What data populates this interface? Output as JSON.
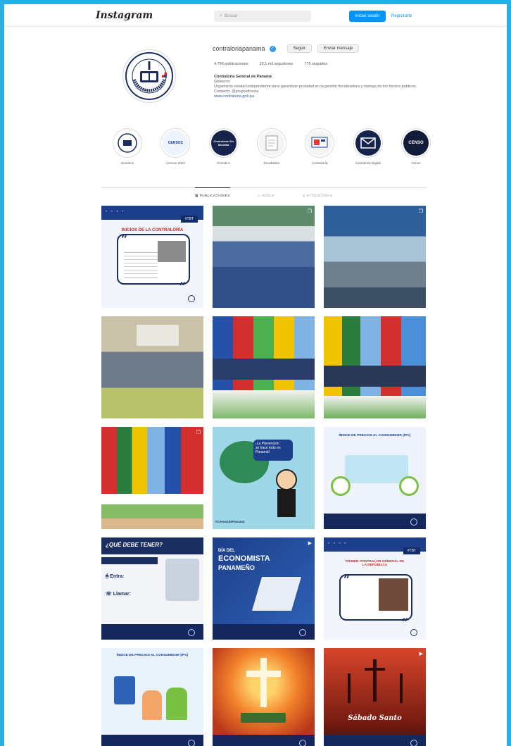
{
  "topbar": {
    "logo": "Instagram",
    "search_placeholder": "Buscar",
    "login_label": "Iniciar sesión",
    "signup_label": "Registrarte"
  },
  "profile": {
    "username": "contraloriapanama",
    "follow_label": "Seguir",
    "message_label": "Enviar mensaje",
    "stats": {
      "posts": "4.796 publicaciones",
      "followers": "23,1 mil seguidores",
      "following": "775 seguidos"
    },
    "bio": {
      "name": "Contraloría General de Panamá",
      "category": "Gobierno",
      "description": "Organismo estatal independiente para garantizar probidad en la gestión fiscalizadora y manejo de los fondos públicos.",
      "contact": "Contacto: @grupoeficacia",
      "website": "www.contraloria.gob.pa"
    }
  },
  "highlights": [
    {
      "label": "Nosotros",
      "bg": "#ffffff",
      "text": ""
    },
    {
      "label": "Censos 2023",
      "bg": "#eef4fb",
      "text": "CENSOS"
    },
    {
      "label": "Periódico",
      "bg": "#16244d",
      "text": "Contraloría Sin Mordida"
    },
    {
      "label": "Resultados",
      "bg": "#f4f4f4",
      "text": ""
    },
    {
      "label": "Contraloría",
      "bg": "#f4f4f4",
      "text": ""
    },
    {
      "label": "Contraloría Digital",
      "bg": "#16244d",
      "text": "Contraloría"
    },
    {
      "label": "Censo",
      "bg": "#101c3a",
      "text": "CENSO"
    }
  ],
  "tabs": [
    "PUBLICACIONES",
    "REELS",
    "ETIQUETADAS"
  ],
  "posts": {
    "p1_tag": "#TBT",
    "p1_title": "INICIOS DE LA CONTRALORÍA",
    "p8_line1": "¡La Prevención",
    "p8_line2": "se hace todo en Panamá!",
    "p8_hashtag": "#CensosdePanamá",
    "p9_title": "ÍNDICE DE PRECIOS AL CONSUMIDOR (IPC)",
    "p10_title": "¿QUÉ DEBE TENER?",
    "p10_entra": "Entra:",
    "p10_llamar": "Llamar:",
    "p11_line1": "DÍA DEL",
    "p11_line2": "ECONOMISTA",
    "p11_line3": "PANAMEÑO",
    "p12_tag": "#TBT",
    "p12_title": "PRIMER CONTRALOR GENERAL DE LA REPÚBLICA",
    "p13_title": "ÍNDICE DE PRECIOS AL CONSUMIDOR (IPC)",
    "p15_text": "Sábado Santo"
  },
  "colors": {
    "frame": "#29aee6",
    "navy": "#1b2d5f",
    "accent_blue": "#0095f6"
  }
}
